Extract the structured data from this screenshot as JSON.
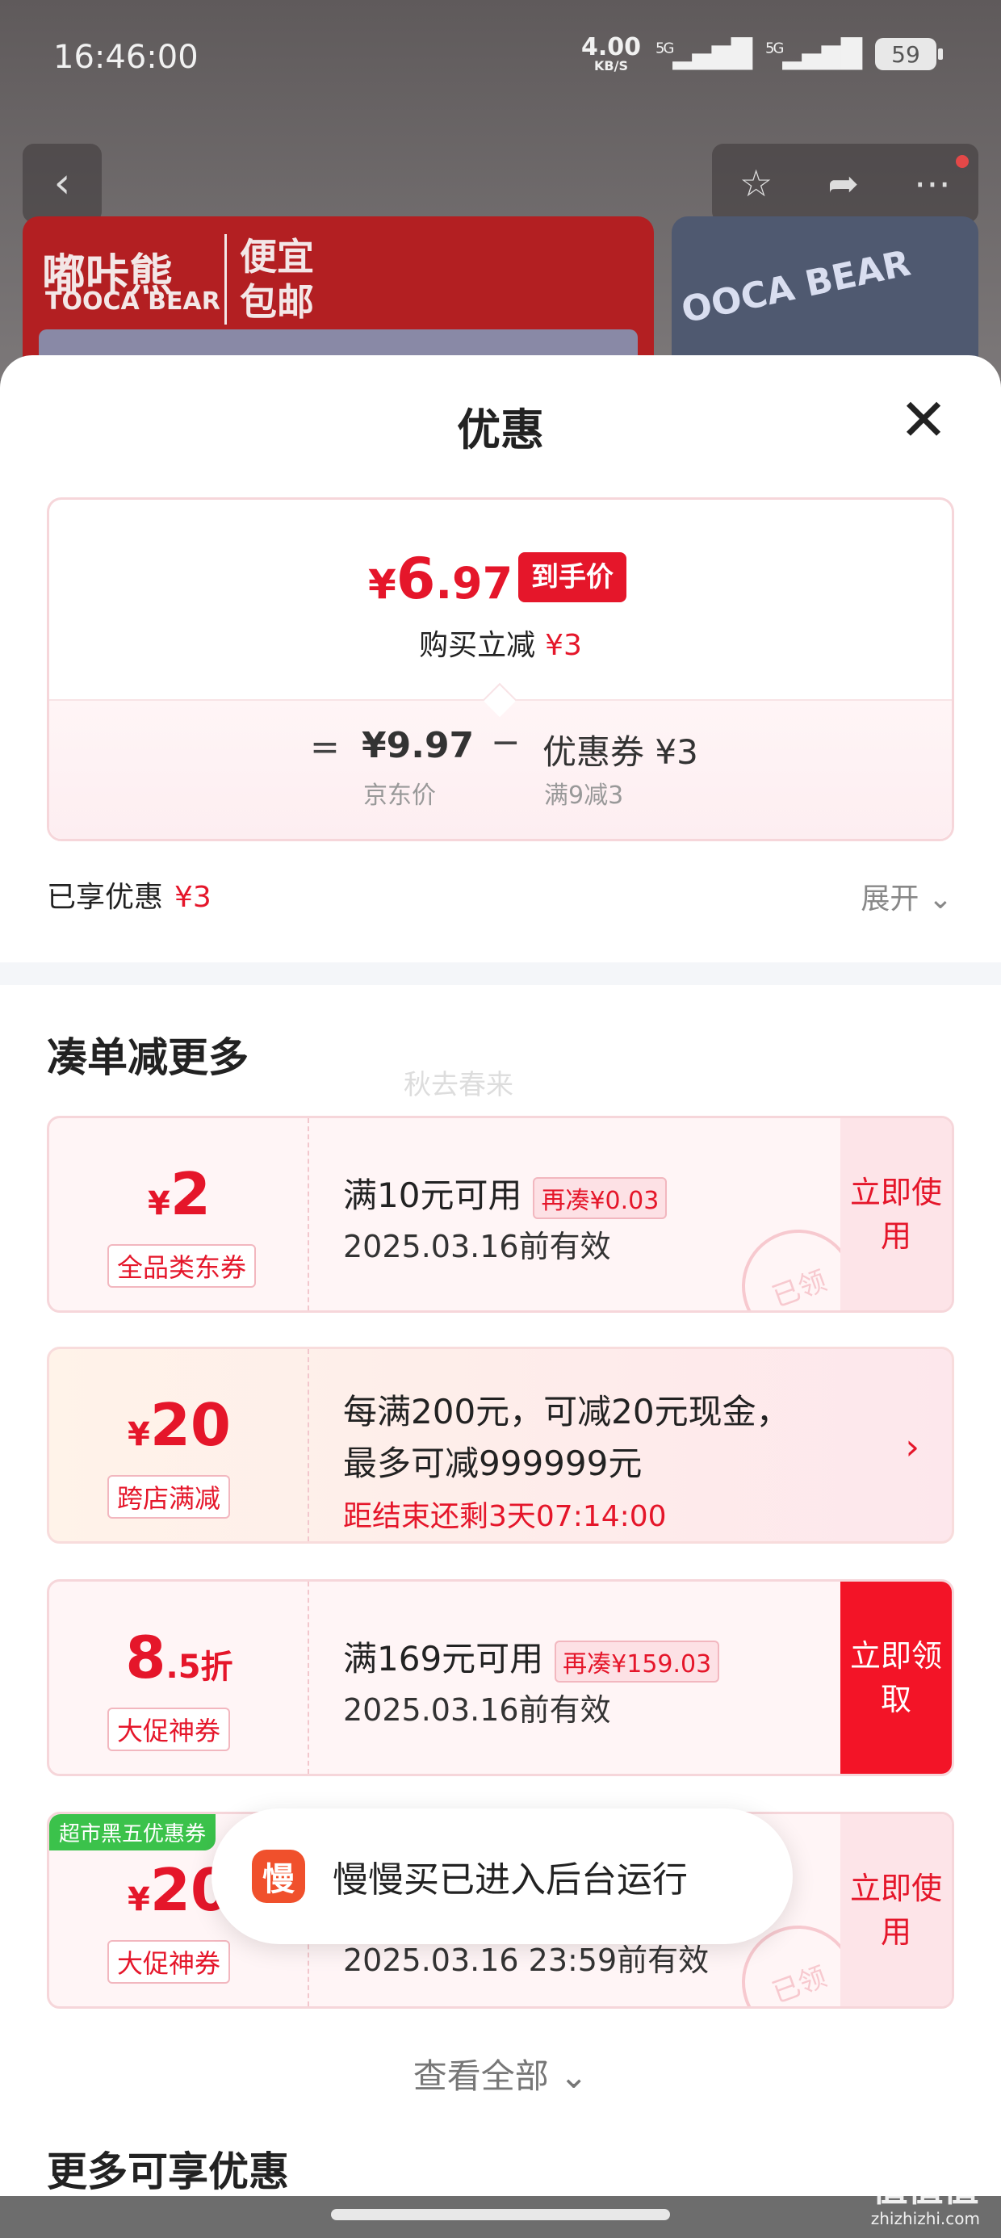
{
  "status_bar": {
    "time": "16:46:00",
    "net_speed": "4.00",
    "net_unit": "KB/S",
    "signal1": "5G",
    "signal2": "5G",
    "battery": "59"
  },
  "background_banner": {
    "brand_cn": "嘟咔熊",
    "brand_en": "TOOCA BEAR",
    "tag": [
      "便宜",
      "包邮"
    ],
    "right_text": "OOCA BEAR"
  },
  "sheet": {
    "title": "优惠",
    "price": {
      "currency": "¥",
      "integer": "6",
      "decimal": ".97",
      "badge": "到手价",
      "reduce_label": "购买立减",
      "reduce_amount": "¥3",
      "jd_price": "¥9.97",
      "jd_label": "京东价",
      "coupon_price": "优惠券 ¥3",
      "coupon_label": "满9减3"
    },
    "enjoyed_label": "已享优惠",
    "enjoyed_amount": "¥3",
    "expand_label": "展开"
  },
  "more_section": {
    "title": "凑单减更多",
    "watermark": "秋去春来",
    "coupons": [
      {
        "currency": "¥",
        "amount": "2",
        "type": "全品类东券",
        "main": "满10元可用",
        "extra": "再凑¥0.03",
        "sub": "2025.03.16前有效",
        "action": "立即使用",
        "stamp": "已领"
      },
      {
        "currency": "¥",
        "amount": "20",
        "type": "跨店满减",
        "main_line1": "每满200元，可减20元现金，",
        "main_line2": "最多可减999999元",
        "countdown": "距结束还剩3天07:14:00"
      },
      {
        "amount": "8",
        "suffix": ".5折",
        "type": "大促神券",
        "main": "满169元可用",
        "extra": "再凑¥159.03",
        "sub": "2025.03.16前有效",
        "action": "立即领取"
      },
      {
        "corner": "超市黑五优惠券",
        "currency": "¥",
        "amount": "20",
        "type": "大促神券",
        "sub": "2025.03.16 23:59前有效",
        "action": "立即使用",
        "stamp": "已领"
      }
    ],
    "view_all": "查看全部"
  },
  "toast": {
    "icon_char": "慢",
    "text": "慢慢买已进入后台运行"
  },
  "more_enjoy_title": "更多可享优惠",
  "site_watermark": {
    "main": "值值值",
    "sub": "zhizhizhi.com"
  },
  "colors": {
    "accent": "#e5162a",
    "action_solid": "#f31427",
    "toast_icon": "#f0502c",
    "green_tag": "#3bc24b"
  }
}
